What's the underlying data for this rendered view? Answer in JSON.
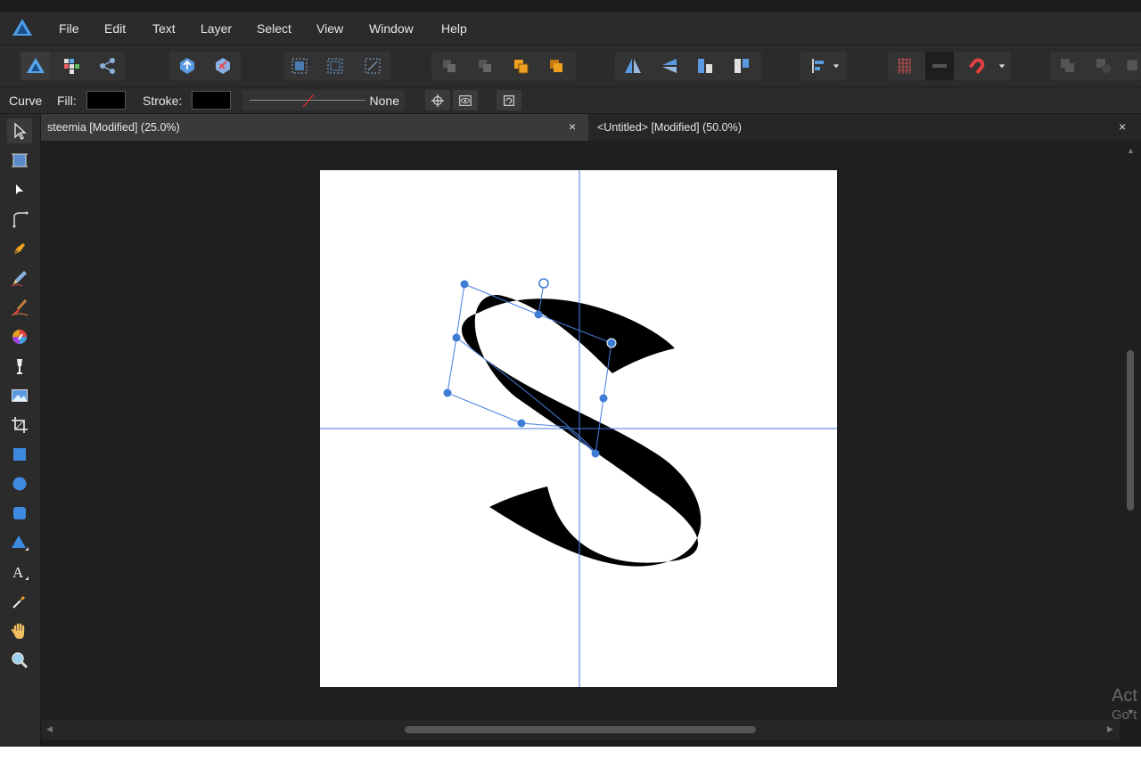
{
  "menu": [
    "File",
    "Edit",
    "Text",
    "Layer",
    "Select",
    "View",
    "Window",
    "Help"
  ],
  "context": {
    "tool_name": "Curve",
    "fill_label": "Fill:",
    "stroke_label": "Stroke:",
    "stroke_width": "None"
  },
  "tabs": [
    {
      "title": "steemia [Modified] (25.0%)",
      "close": "×"
    },
    {
      "title": "<Untitled> [Modified] (50.0%)",
      "close": "×"
    }
  ],
  "watermark": {
    "line1": "Act",
    "line2": "Go t"
  },
  "colors": {
    "accent": "#3d7dd6",
    "app_bg": "#2b2b2b",
    "workspace": "#1f1f1f",
    "canvas": "#ffffff",
    "orange": "#f0a020"
  },
  "icons": {
    "personas": [
      "designer-persona-icon",
      "pixel-persona-icon",
      "export-persona-icon"
    ],
    "tools": [
      "move-tool-icon",
      "artboard-tool-icon",
      "node-tool-icon",
      "corner-tool-icon",
      "pen-tool-icon",
      "pencil-tool-icon",
      "vector-brush-icon",
      "color-picker-wheel-icon",
      "fill-tool-icon",
      "place-image-icon",
      "crop-tool-icon",
      "rectangle-tool-icon",
      "ellipse-tool-icon",
      "rounded-rect-tool-icon",
      "triangle-tool-icon",
      "artistic-text-icon",
      "eyedropper-icon",
      "hand-tool-icon",
      "zoom-tool-icon"
    ]
  }
}
